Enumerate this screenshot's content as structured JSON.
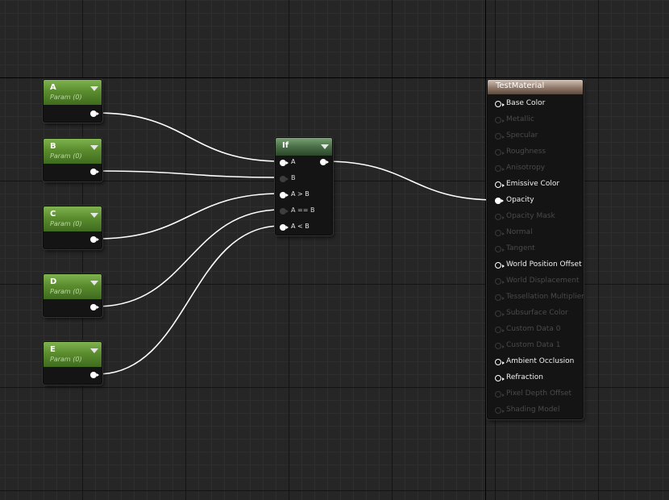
{
  "param_nodes": [
    {
      "title": "A",
      "subtitle": "Param (0)"
    },
    {
      "title": "B",
      "subtitle": "Param (0)"
    },
    {
      "title": "C",
      "subtitle": "Param (0)"
    },
    {
      "title": "D",
      "subtitle": "Param (0)"
    },
    {
      "title": "E",
      "subtitle": "Param (0)"
    }
  ],
  "if_node": {
    "title": "If",
    "inputs": [
      {
        "label": "A",
        "connected": true
      },
      {
        "label": "B",
        "connected": true
      },
      {
        "label": "A > B",
        "connected": true
      },
      {
        "label": "A == B",
        "connected": true
      },
      {
        "label": "A < B",
        "connected": true
      }
    ]
  },
  "material_node": {
    "title": "TestMaterial",
    "inputs": [
      {
        "label": "Base Color",
        "enabled": true
      },
      {
        "label": "Metallic",
        "enabled": false
      },
      {
        "label": "Specular",
        "enabled": false
      },
      {
        "label": "Roughness",
        "enabled": false
      },
      {
        "label": "Anisotropy",
        "enabled": false
      },
      {
        "label": "Emissive Color",
        "enabled": true
      },
      {
        "label": "Opacity",
        "enabled": true
      },
      {
        "label": "Opacity Mask",
        "enabled": false
      },
      {
        "label": "Normal",
        "enabled": false
      },
      {
        "label": "Tangent",
        "enabled": false
      },
      {
        "label": "World Position Offset",
        "enabled": true
      },
      {
        "label": "World Displacement",
        "enabled": false
      },
      {
        "label": "Tessellation Multiplier",
        "enabled": false
      },
      {
        "label": "Subsurface Color",
        "enabled": false
      },
      {
        "label": "Custom Data 0",
        "enabled": false
      },
      {
        "label": "Custom Data 1",
        "enabled": false
      },
      {
        "label": "Ambient Occlusion",
        "enabled": true
      },
      {
        "label": "Refraction",
        "enabled": true
      },
      {
        "label": "Pixel Depth Offset",
        "enabled": false
      },
      {
        "label": "Shading Model",
        "enabled": false
      }
    ]
  },
  "connections": [
    {
      "from": "A",
      "to": "If.A"
    },
    {
      "from": "B",
      "to": "If.B"
    },
    {
      "from": "C",
      "to": "If.A > B"
    },
    {
      "from": "D",
      "to": "If.A == B"
    },
    {
      "from": "E",
      "to": "If.A < B"
    },
    {
      "from": "If",
      "to": "TestMaterial.Opacity"
    }
  ],
  "colors": {
    "param_header": "#5b8d2f",
    "if_header": "#4a6f47",
    "material_header": "#8f7868",
    "wire": "#ffffff",
    "canvas": "#262626"
  }
}
